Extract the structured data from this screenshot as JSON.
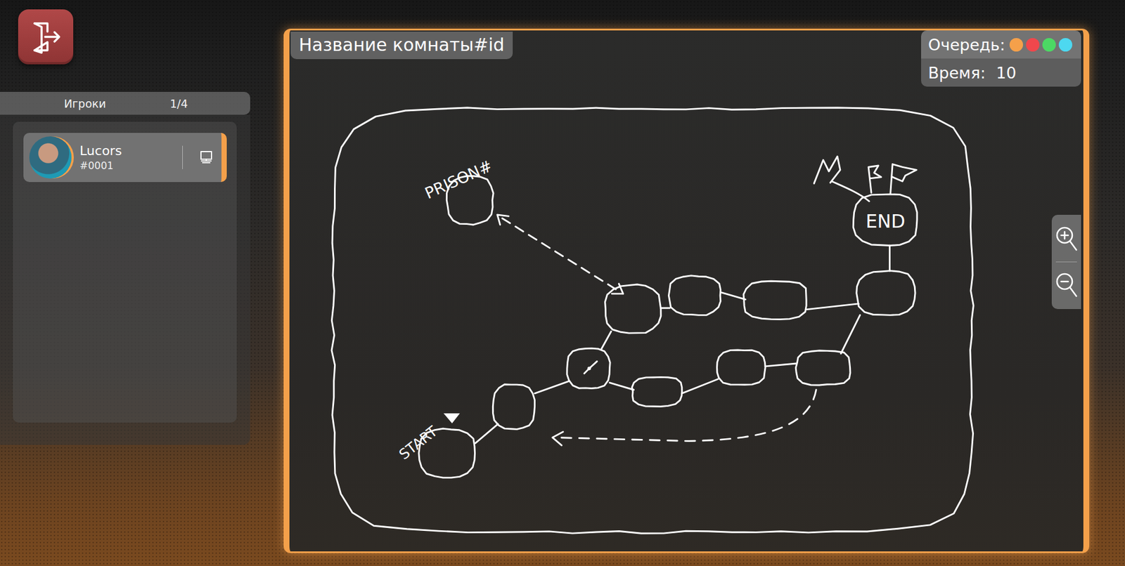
{
  "room": {
    "title": "Название комнаты#id"
  },
  "turn": {
    "label": "Очередь:",
    "queue": [
      {
        "color": "#f5a04a"
      },
      {
        "color": "#f0474c"
      },
      {
        "color": "#4cd964"
      },
      {
        "color": "#4dd8f0"
      }
    ]
  },
  "timer": {
    "label": "Время:",
    "value": "10"
  },
  "players_panel": {
    "title": "Игроки",
    "count": "1/4",
    "players": [
      {
        "name": "Lucors",
        "tag": "#0001",
        "selected": true
      }
    ]
  },
  "map": {
    "labels": {
      "prison": "PRISON#",
      "start": "START",
      "end": "END"
    }
  }
}
